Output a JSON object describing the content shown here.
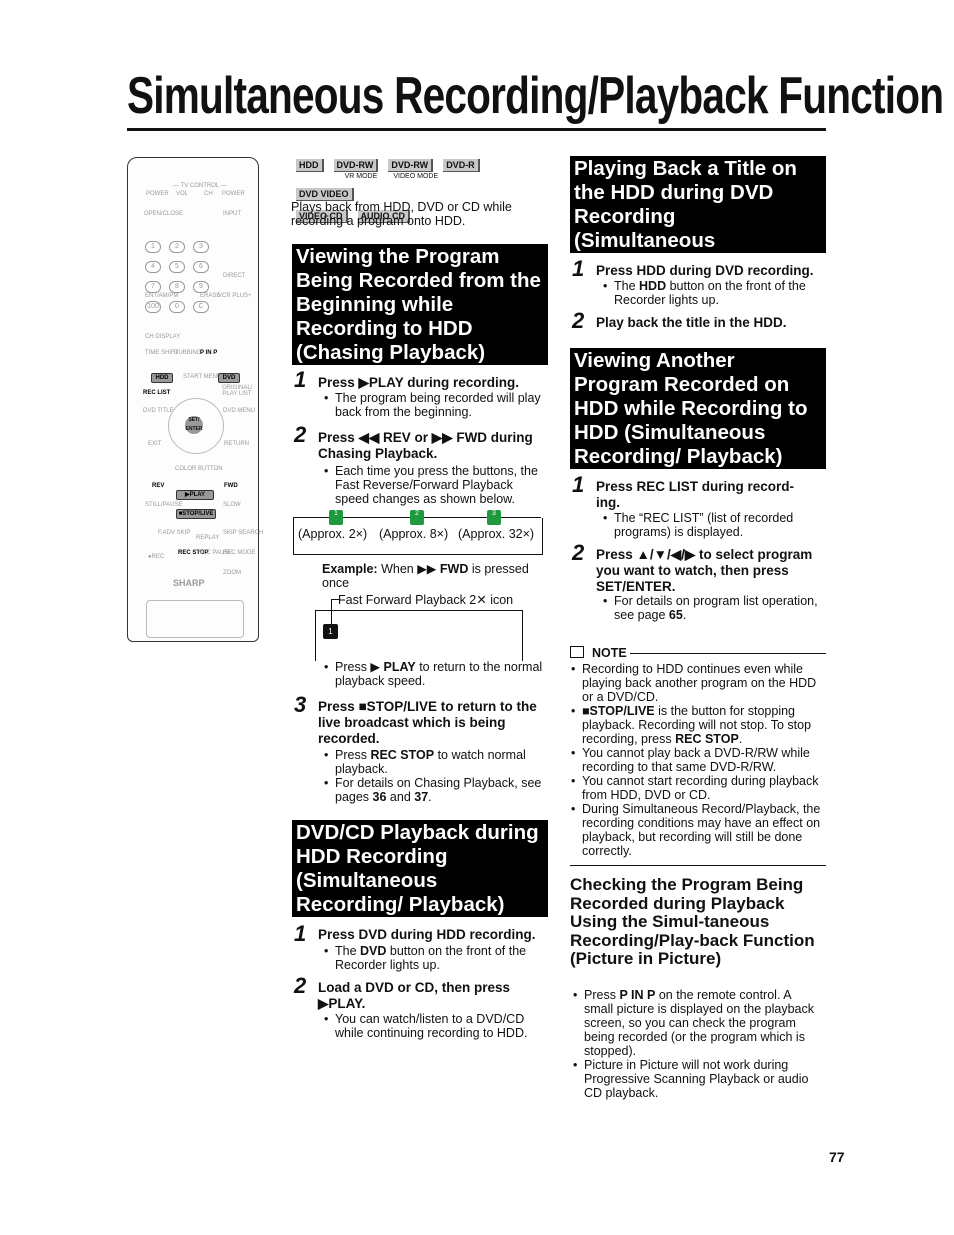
{
  "title": "Simultaneous Recording/Playback Function",
  "page_number": "77",
  "badges": [
    {
      "label": "HDD",
      "sub": ""
    },
    {
      "label": "DVD-RW",
      "sub": "VR MODE"
    },
    {
      "label": "DVD-RW",
      "sub": "VIDEO MODE"
    },
    {
      "label": "DVD-R",
      "sub": ""
    },
    {
      "label": "DVD VIDEO",
      "sub": ""
    },
    {
      "label": "VIDEO CD",
      "sub": ""
    },
    {
      "label": "AUDIO CD",
      "sub": ""
    }
  ],
  "intro": "Plays back from HDD, DVD or CD while recording a program onto HDD.",
  "remote": {
    "tv_control": "— TV CONTROL —",
    "power": "POWER",
    "vol": "VOL",
    "ch": "CH",
    "open_close": "OPEN/CLOSE",
    "input": "INPUT",
    "direct": "DIRECT",
    "ent": "ENT/AM/PM",
    "erase": "ERASE",
    "vcrplus": "VCR PLUS+",
    "ch_display": "CH DISPLAY",
    "time_shift": "TIME SHIFT",
    "dubbing": "DUBBING",
    "pinp": "P IN P",
    "hdd": "HDD",
    "start_menu": "START MENU",
    "dvd": "DVD",
    "rec_list": "REC LIST",
    "original": "ORIGINAL/ PLAY LIST",
    "dvd_title": "DVD TITLE",
    "dvd_menu": "DVD MENU",
    "set_enter": "SET/ ENTER",
    "exit": "EXIT",
    "return": "RETURN",
    "color_button": "COLOR BUTTON",
    "rev": "REV",
    "fwd": "FWD",
    "play": "▶PLAY",
    "still": "STILL/PAUSE",
    "slow": "SLOW",
    "stop": "■STOP/LIVE",
    "fadv": "F.ADV SKIP",
    "replay": "REPLAY",
    "skip_search": "SKIP SEARCH",
    "rec": "●REC",
    "rec_stop": "REC STOP",
    "rec_pause": "REC PAUSE",
    "rec_mode": "REC MODE",
    "zoom": "ZOOM",
    "brand": "SHARP",
    "digits": [
      "1",
      "2",
      "3",
      "4",
      "5",
      "6",
      "7",
      "8",
      "9",
      "100",
      "0",
      "C"
    ]
  },
  "sec1": {
    "heading": "Viewing the Program Being Recorded from the Beginning while Recording to HDD (Chasing Playback)",
    "step1": {
      "n": "1",
      "text": [
        [
          "Press ",
          1
        ],
        [
          "▶PLAY",
          1
        ],
        [
          " during recording.",
          1
        ]
      ],
      "bullets": [
        [
          [
            "The program being recorded will play back from the beginning.",
            0
          ]
        ]
      ]
    },
    "step2": {
      "n": "2",
      "text": [
        [
          "Press ◀◀ REV or ▶▶ FWD during Chasing Playback.",
          1
        ]
      ],
      "bullets": [
        [
          [
            "Each time you press the buttons, the Fast Reverse/Forward Playback speed changes as shown below.",
            0
          ]
        ]
      ]
    },
    "speeds": [
      "(Approx. 2×)",
      "(Approx. 8×)",
      "(Approx. 32×)"
    ],
    "speed_icons": [
      "1",
      "2",
      "3"
    ],
    "example": [
      [
        "Example:",
        1
      ],
      [
        " When ▶▶ ",
        0
      ],
      [
        "FWD",
        1
      ],
      [
        " is pressed once",
        0
      ]
    ],
    "caption": "Fast Forward Playback 2✕ icon",
    "screen_icon": "1",
    "bullet_play": [
      [
        "Press ▶ ",
        0
      ],
      [
        "PLAY",
        1
      ],
      [
        " to return to the normal playback speed.",
        0
      ]
    ],
    "step3": {
      "n": "3",
      "text": [
        [
          "Press ■STOP/LIVE to return to the live broadcast which is being recorded.",
          1
        ]
      ],
      "bullets": [
        [
          [
            "Press ",
            0
          ],
          [
            "REC STOP",
            1
          ],
          [
            " to watch normal playback.",
            0
          ]
        ],
        [
          [
            "For details on Chasing Playback, see pages ",
            0
          ],
          [
            "36",
            1
          ],
          [
            " and ",
            0
          ],
          [
            "37",
            1
          ],
          [
            ".",
            0
          ]
        ]
      ]
    }
  },
  "sec2": {
    "heading": "DVD/CD Playback during HDD Recording (Simultaneous Recording/ Playback)",
    "step1": {
      "n": "1",
      "text": [
        [
          "Press DVD during HDD recording.",
          1
        ]
      ],
      "bullets": [
        [
          [
            "The ",
            0
          ],
          [
            "DVD",
            1
          ],
          [
            " button on the front of the Recorder lights up.",
            0
          ]
        ]
      ]
    },
    "step2": {
      "n": "2",
      "text": [
        [
          "Load a DVD or CD, then press ▶PLAY.",
          1
        ]
      ],
      "bullets": [
        [
          [
            "You can watch/listen to a DVD/CD while continuing recording to HDD.",
            0
          ]
        ]
      ]
    }
  },
  "sec3": {
    "heading": "Playing Back a Title on the HDD during DVD Recording (Simultaneous Recording/Playback)",
    "step1": {
      "n": "1",
      "text": [
        [
          "Press HDD during DVD recording.",
          1
        ]
      ],
      "bullets": [
        [
          [
            "The ",
            0
          ],
          [
            "HDD",
            1
          ],
          [
            " button on the front of the Recorder lights up.",
            0
          ]
        ]
      ]
    },
    "step2": {
      "n": "2",
      "text": [
        [
          "Play back the title in the HDD.",
          1
        ]
      ]
    }
  },
  "sec4": {
    "heading": "Viewing Another Program Recorded on HDD while Recording to HDD (Simultaneous Recording/ Playback)",
    "step1": {
      "n": "1",
      "text": [
        [
          "Press REC LIST during record-ing.",
          1
        ]
      ],
      "bullets": [
        [
          [
            "The “REC LIST” (list of recorded programs) is displayed.",
            0
          ]
        ]
      ]
    },
    "step2": {
      "n": "2",
      "text": [
        [
          "Press ▲/▼/◀/▶ to select program you want to watch, then press SET/ENTER.",
          1
        ]
      ],
      "bullets": [
        [
          [
            "For details on program list operation, see page ",
            0
          ],
          [
            "65",
            1
          ],
          [
            ".",
            0
          ]
        ]
      ]
    }
  },
  "note": {
    "label": "NOTE",
    "bullets": [
      [
        [
          "Recording to HDD continues even while playing back another program on the HDD or a DVD/CD.",
          0
        ]
      ],
      [
        [
          "■STOP/LIVE",
          1
        ],
        [
          " is the button for stopping playback. Recording will not stop. To stop recording, press ",
          0
        ],
        [
          "REC STOP",
          1
        ],
        [
          ".",
          0
        ]
      ],
      [
        [
          "You cannot play back a DVD-R/RW while recording to that same DVD-R/RW.",
          0
        ]
      ],
      [
        [
          "You cannot start recording during playback from HDD, DVD or CD.",
          0
        ]
      ],
      [
        [
          "During Simultaneous Record/Playback, the recording conditions may have an effect on playback, but recording will still be done correctly.",
          0
        ]
      ]
    ]
  },
  "sec5": {
    "heading": "Checking the Program Being Recorded during Playback Using the Simul-taneous Recording/Play-back Function (Picture in Picture)",
    "bullets": [
      [
        [
          "Press ",
          0
        ],
        [
          "P IN P",
          1
        ],
        [
          " on the remote control. A small picture is displayed on the playback screen, so you can check the program being recorded (or the program which is stopped).",
          0
        ]
      ],
      [
        [
          "Picture in Picture will not work during Progressive Scanning Playback or audio CD playback.",
          0
        ]
      ]
    ]
  }
}
